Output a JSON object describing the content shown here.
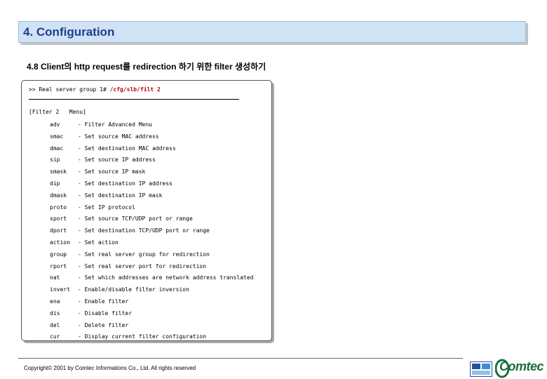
{
  "slide": {
    "title": "4. Configuration",
    "section_heading": "4.8 Client의 http request를 redirection 하기 위한 filter 생성하기"
  },
  "terminal": {
    "command_prefix": ">> Real server group 1# ",
    "command_path": "/cfg/slb/filt 2",
    "menu_header": "[Filter 2   Menu]",
    "items": [
      {
        "key": "adv",
        "desc": "- Filter Advanced Menu"
      },
      {
        "key": "smac",
        "desc": "- Set source MAC address"
      },
      {
        "key": "dmac",
        "desc": "- Set destination MAC address"
      },
      {
        "key": "sip",
        "desc": "- Set source IP address"
      },
      {
        "key": "smask",
        "desc": "- Set source IP mask"
      },
      {
        "key": "dip",
        "desc": "- Set destination IP address"
      },
      {
        "key": "dmask",
        "desc": "- Set destination IP mask"
      },
      {
        "key": "proto",
        "desc": "- Set IP protocol"
      },
      {
        "key": "sport",
        "desc": "- Set source TCP/UDP port or range"
      },
      {
        "key": "dport",
        "desc": "- Set destination TCP/UDP port or range"
      },
      {
        "key": "action",
        "desc": "- Set action"
      },
      {
        "key": "group",
        "desc": "- Set real server group for redirection"
      },
      {
        "key": "rport",
        "desc": "- Set real server port for redirection"
      },
      {
        "key": "nat",
        "desc": "- Set which addresses are network address translated"
      },
      {
        "key": "invert",
        "desc": "- Enable/disable filter inversion"
      },
      {
        "key": "ena",
        "desc": "- Enable filter"
      },
      {
        "key": "dis",
        "desc": "- Disable filter"
      },
      {
        "key": "del",
        "desc": "- Delete filter"
      },
      {
        "key": "cur",
        "desc": "- Display current filter configuration"
      }
    ]
  },
  "footer": {
    "copyright": "Copyright© 2001 by Comtec Informations Co., Ltd. All rights reserved",
    "logo_text": "Comtec"
  },
  "colors": {
    "title_bar_bg": "#cfe3f5",
    "title_text": "#1f3d8f",
    "command_path": "#b30000",
    "logo_green": "#1b6e3a"
  }
}
